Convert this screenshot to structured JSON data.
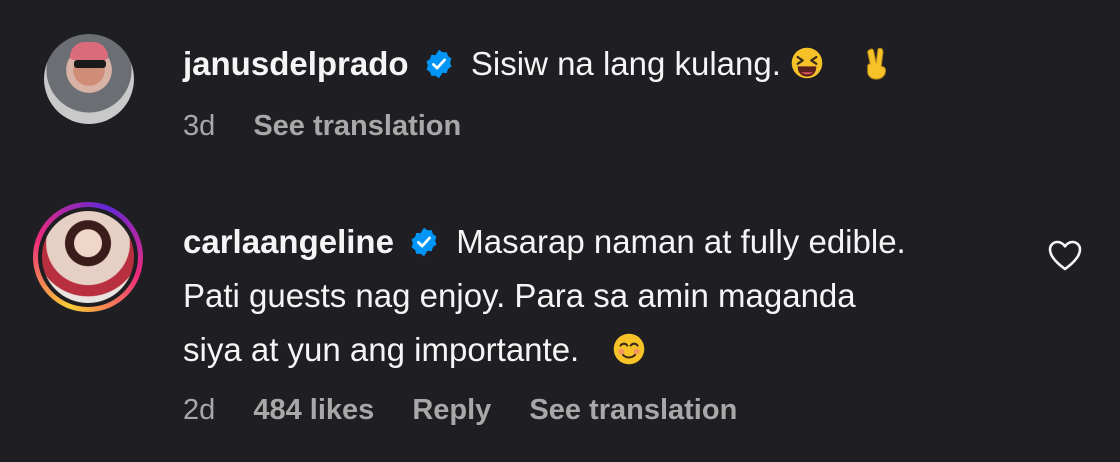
{
  "comments": [
    {
      "username": "janusdelprado",
      "text_lines": [
        "Sisiw na lang kulang."
      ],
      "emoji": [
        "laughing-face",
        "victory-hand"
      ],
      "time": "3d",
      "see_translation": "See translation"
    },
    {
      "username": "carlaangeline",
      "text_lines": [
        "Masarap naman at fully edible.",
        "Pati guests nag enjoy. Para sa amin maganda",
        "siya at yun ang importante."
      ],
      "emoji": [
        "smiling-face-with-smiling-eyes"
      ],
      "time": "2d",
      "likes": "484 likes",
      "reply": "Reply",
      "see_translation": "See translation"
    }
  ],
  "colors": {
    "background": "#1f1f23",
    "text": "#f5f5f5",
    "meta": "#a8a8a8",
    "verified": "#0095f6"
  }
}
